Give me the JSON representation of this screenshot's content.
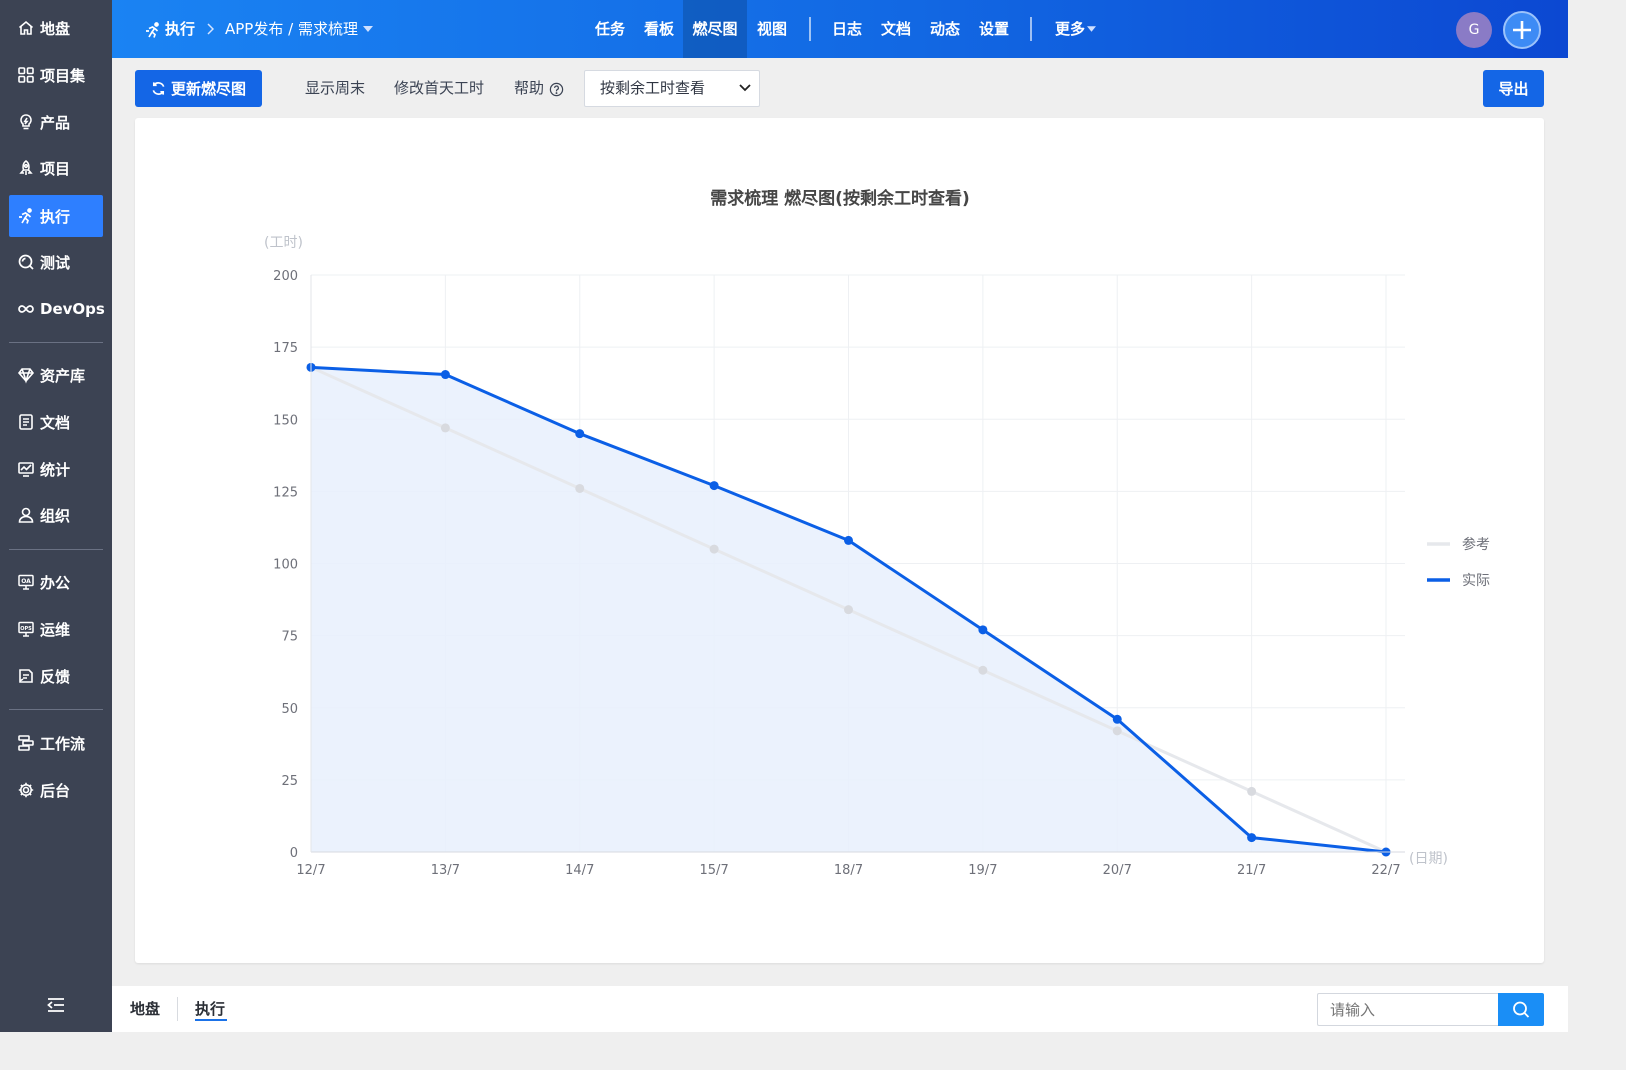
{
  "sidebar": {
    "items": [
      {
        "label": "地盘",
        "icon": "home-icon",
        "active": false
      },
      {
        "label": "项目集",
        "icon": "grid-icon",
        "active": false
      },
      {
        "label": "产品",
        "icon": "lightbulb-icon",
        "active": false
      },
      {
        "label": "项目",
        "icon": "rocket-icon",
        "active": false
      },
      {
        "label": "执行",
        "icon": "run-icon",
        "active": true
      },
      {
        "label": "测试",
        "icon": "test-icon",
        "active": false
      },
      {
        "label": "DevOps",
        "icon": "infinity-icon",
        "active": false
      },
      {
        "label": "资产库",
        "icon": "diamond-icon",
        "active": false
      },
      {
        "label": "文档",
        "icon": "document-icon",
        "active": false
      },
      {
        "label": "统计",
        "icon": "stats-icon",
        "active": false
      },
      {
        "label": "组织",
        "icon": "user-icon",
        "active": false
      },
      {
        "label": "办公",
        "icon": "oa-icon",
        "active": false
      },
      {
        "label": "运维",
        "icon": "ops-icon",
        "active": false
      },
      {
        "label": "反馈",
        "icon": "feedback-icon",
        "active": false
      },
      {
        "label": "工作流",
        "icon": "workflow-icon",
        "active": false
      },
      {
        "label": "后台",
        "icon": "gear-icon",
        "active": false
      }
    ],
    "collapse_icon": "collapse-menu-icon"
  },
  "header": {
    "module": "执行",
    "breadcrumb": "APP发布 / 需求梳理",
    "tabs": [
      "任务",
      "看板",
      "燃尽图",
      "视图",
      "日志",
      "文档",
      "动态",
      "设置",
      "更多"
    ],
    "active_tab": "燃尽图",
    "avatar_letter": "G"
  },
  "toolbar": {
    "refresh_label": "更新燃尽图",
    "show_weekend": "显示周末",
    "edit_first_day": "修改首天工时",
    "help": "帮助",
    "view_select_value": "按剩余工时查看",
    "export_label": "导出"
  },
  "chart_data": {
    "type": "line",
    "title": "需求梳理 燃尽图(按剩余工时查看)",
    "ylabel": "(工时)",
    "xlabel": "(日期)",
    "ylim": [
      0,
      200
    ],
    "yticks": [
      0,
      25,
      50,
      75,
      100,
      125,
      150,
      175,
      200
    ],
    "categories": [
      "12/7",
      "13/7",
      "14/7",
      "15/7",
      "18/7",
      "19/7",
      "20/7",
      "21/7",
      "22/7"
    ],
    "series": [
      {
        "name": "参考",
        "color": "#e6e8ec",
        "values": [
          168,
          147,
          126,
          105,
          84,
          63,
          42,
          21,
          0
        ]
      },
      {
        "name": "实际",
        "color": "#0b5fe6",
        "values": [
          168,
          165.5,
          145,
          127,
          108,
          77,
          46,
          5,
          0
        ]
      }
    ],
    "fill": "actual-area",
    "grid": true,
    "legend_position": "right"
  },
  "statusbar": {
    "crumb_home": "地盘",
    "crumb_current": "执行",
    "search_placeholder": "请输入"
  },
  "colors": {
    "sidebar_bg": "#3c4353",
    "accent": "#1466e6",
    "actual_line": "#0b5fe6",
    "reference_line": "#e6e8ec"
  }
}
